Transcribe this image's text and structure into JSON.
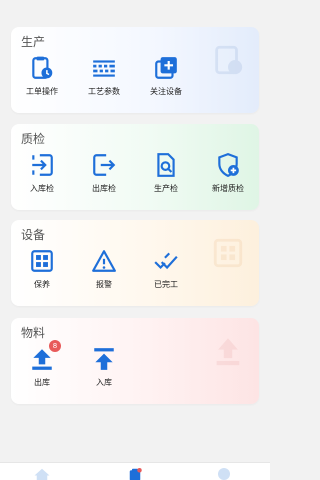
{
  "sections": {
    "production": {
      "title": "生产",
      "items": [
        {
          "label": "工单操作",
          "icon": "clipboard-clock-icon"
        },
        {
          "label": "工艺参数",
          "icon": "keyboard-icon"
        },
        {
          "label": "关注设备",
          "icon": "add-square-icon"
        }
      ]
    },
    "quality": {
      "title": "质检",
      "items": [
        {
          "label": "入库检",
          "icon": "login-arrow-icon"
        },
        {
          "label": "出库检",
          "icon": "logout-arrow-icon"
        },
        {
          "label": "生产检",
          "icon": "document-search-icon"
        },
        {
          "label": "新增质检",
          "icon": "shield-add-icon"
        }
      ]
    },
    "equipment": {
      "title": "设备",
      "items": [
        {
          "label": "保养",
          "icon": "grid-chip-icon"
        },
        {
          "label": "报警",
          "icon": "warning-triangle-icon"
        },
        {
          "label": "已完工",
          "icon": "double-check-icon"
        }
      ]
    },
    "material": {
      "title": "物料",
      "items": [
        {
          "label": "出库",
          "icon": "upload-tray-icon",
          "badge": "8"
        },
        {
          "label": "入库",
          "icon": "arrow-up-bar-icon"
        }
      ]
    }
  },
  "tabbar": {
    "tabs": [
      {
        "icon": "home-icon"
      },
      {
        "icon": "clipboard-icon"
      },
      {
        "icon": "user-icon"
      }
    ]
  },
  "colors": {
    "primary": "#1e6fd9",
    "badge": "#e85a5a",
    "tab_inactive": "#cfe0f5"
  }
}
